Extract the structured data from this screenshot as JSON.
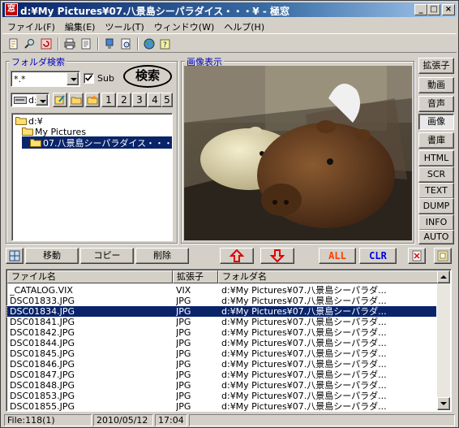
{
  "window": {
    "title": "d:¥My Pictures¥07.八景島シーパラダイス・・・¥ - 極窓",
    "app_icon_text": "窓",
    "minimize": "_",
    "maximize": "□",
    "close": "×"
  },
  "menu": [
    "ファイル(F)",
    "編集(E)",
    "ツール(T)",
    "ウィンドウ(W)",
    "ヘルプ(H)"
  ],
  "toolbar_icons": [
    "new-file-icon",
    "search-icon",
    "refresh-icon",
    "print-icon",
    "page-icon",
    "info-icon",
    "preview-icon",
    "globe-icon",
    "help-icon"
  ],
  "folder_search": {
    "label": "フォルダ検索",
    "pattern": "*.*",
    "sub_label": "Sub",
    "sub_checked": true,
    "search_button": "検索",
    "drive": "d:",
    "numbered_buttons": [
      "1",
      "2",
      "3",
      "4",
      "5"
    ],
    "tree": [
      {
        "label": "d:¥",
        "level": 0,
        "selected": false
      },
      {
        "label": "My Pictures",
        "level": 1,
        "selected": false
      },
      {
        "label": "07.八景島シーパラダイス・・・",
        "level": 2,
        "selected": true
      }
    ]
  },
  "image_view": {
    "label": "画像表示"
  },
  "side_buttons": [
    "拡張子",
    "動画",
    "音声",
    "画像",
    "書庫",
    "HTML",
    "SCR",
    "TEXT",
    "DUMP",
    "INFO",
    "AUTO"
  ],
  "side_active": "画像",
  "actions": {
    "move": "移動",
    "copy": "コピー",
    "delete": "削除",
    "all": "ALL",
    "clr": "CLR"
  },
  "file_list": {
    "columns": [
      "ファイル名",
      "拡張子",
      "フォルダ名"
    ],
    "rows": [
      {
        "name": "_CATALOG.VIX",
        "ext": "VIX",
        "folder": "d:¥My Pictures¥07.八景島シーパラダ...",
        "selected": false
      },
      {
        "name": "DSC01833.JPG",
        "ext": "JPG",
        "folder": "d:¥My Pictures¥07.八景島シーパラダ...",
        "selected": false
      },
      {
        "name": "DSC01834.JPG",
        "ext": "JPG",
        "folder": "d:¥My Pictures¥07.八景島シーパラダ...",
        "selected": true
      },
      {
        "name": "DSC01841.JPG",
        "ext": "JPG",
        "folder": "d:¥My Pictures¥07.八景島シーパラダ...",
        "selected": false
      },
      {
        "name": "DSC01842.JPG",
        "ext": "JPG",
        "folder": "d:¥My Pictures¥07.八景島シーパラダ...",
        "selected": false
      },
      {
        "name": "DSC01844.JPG",
        "ext": "JPG",
        "folder": "d:¥My Pictures¥07.八景島シーパラダ...",
        "selected": false
      },
      {
        "name": "DSC01845.JPG",
        "ext": "JPG",
        "folder": "d:¥My Pictures¥07.八景島シーパラダ...",
        "selected": false
      },
      {
        "name": "DSC01846.JPG",
        "ext": "JPG",
        "folder": "d:¥My Pictures¥07.八景島シーパラダ...",
        "selected": false
      },
      {
        "name": "DSC01847.JPG",
        "ext": "JPG",
        "folder": "d:¥My Pictures¥07.八景島シーパラダ...",
        "selected": false
      },
      {
        "name": "DSC01848.JPG",
        "ext": "JPG",
        "folder": "d:¥My Pictures¥07.八景島シーパラダ...",
        "selected": false
      },
      {
        "name": "DSC01853.JPG",
        "ext": "JPG",
        "folder": "d:¥My Pictures¥07.八景島シーパラダ...",
        "selected": false
      },
      {
        "name": "DSC01855.JPG",
        "ext": "JPG",
        "folder": "d:¥My Pictures¥07.八景島シーパラダ...",
        "selected": false
      }
    ]
  },
  "status": {
    "count": "File:118(1)",
    "date": "2010/05/12",
    "time": "17:04"
  },
  "colors": {
    "titlebar": "#0a246a",
    "selection": "#0a246a",
    "group_label": "#0000c0",
    "arrow_red": "#e00000",
    "all_color": "#ff4000",
    "clr_color": "#0000e0"
  }
}
